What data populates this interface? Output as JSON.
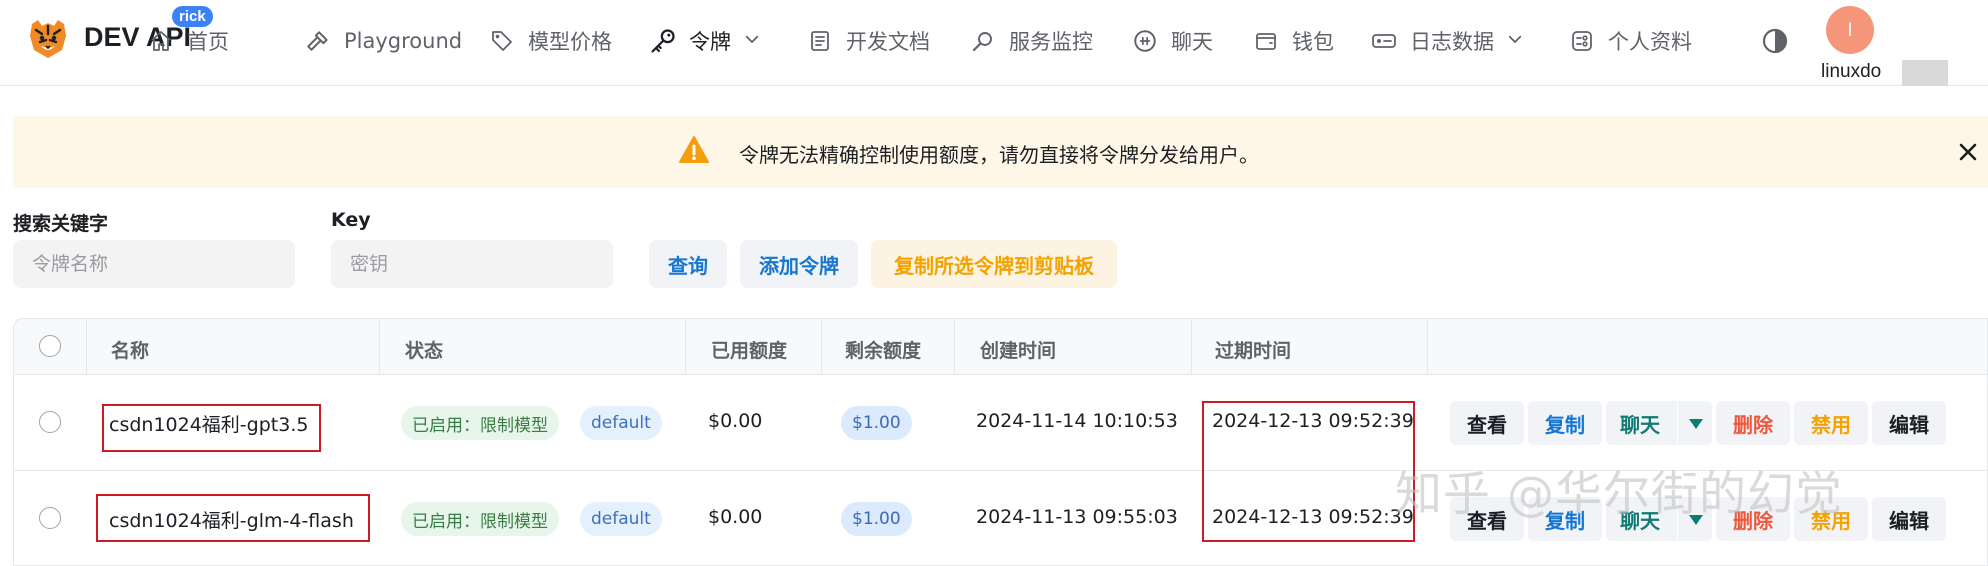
{
  "header": {
    "brand": "DEV API",
    "brand_badge": "rick",
    "nav": [
      {
        "label": "首页",
        "icon": "home-icon"
      },
      {
        "label": "Playground",
        "icon": "hammer-icon"
      },
      {
        "label": "模型价格",
        "icon": "price-tag-icon"
      },
      {
        "label": "令牌",
        "icon": "key-icon"
      },
      {
        "label": "开发文档",
        "icon": "document-icon"
      },
      {
        "label": "服务监控",
        "icon": "magnifier-icon"
      },
      {
        "label": "聊天",
        "icon": "chat-bot-icon"
      },
      {
        "label": "钱包",
        "icon": "wallet-icon"
      },
      {
        "label": "日志数据",
        "icon": "storage-icon"
      },
      {
        "label": "个人资料",
        "icon": "profile-settings-icon"
      }
    ],
    "avatar_letter": "l",
    "username": "linuxdo"
  },
  "banner": {
    "text": "令牌无法精确控制使用额度，请勿直接将令牌分发给用户。",
    "icon": "warning-triangle-icon",
    "close_icon": "close-icon"
  },
  "filters": {
    "keyword_label": "搜索关键字",
    "keyword_placeholder": "令牌名称",
    "key_label": "Key",
    "key_placeholder": "密钥",
    "query_button": "查询",
    "add_button": "添加令牌",
    "copy_button": "复制所选令牌到剪贴板"
  },
  "table": {
    "columns": [
      "名称",
      "状态",
      "已用额度",
      "剩余额度",
      "创建时间",
      "过期时间"
    ],
    "rows": [
      {
        "name": "csdn1024福利-gpt3.5",
        "status": "已启用：限制模型",
        "group": "default",
        "used": "$0.00",
        "remaining": "$1.00",
        "created": "2024-11-14 10:10:53",
        "expires": "2024-12-13 09:52:39"
      },
      {
        "name": "csdn1024福利-glm-4-flash",
        "status": "已启用：限制模型",
        "group": "default",
        "used": "$0.00",
        "remaining": "$1.00",
        "created": "2024-11-13 09:55:03",
        "expires": "2024-12-13 09:52:39"
      }
    ],
    "actions": {
      "view": "查看",
      "copy": "复制",
      "chat": "聊天",
      "delete": "删除",
      "disable": "禁用",
      "edit": "编辑"
    }
  },
  "colors": {
    "action_view": "#1c1f23",
    "action_copy": "#1677d2",
    "action_chat": "#0f7b72",
    "action_delete": "#f0573a",
    "action_disable": "#f3a300",
    "action_edit": "#1c1f23",
    "highlight_box": "#c81d25",
    "warning": "#f59e0b"
  },
  "watermark": "知乎 @华尔街的幻觉"
}
